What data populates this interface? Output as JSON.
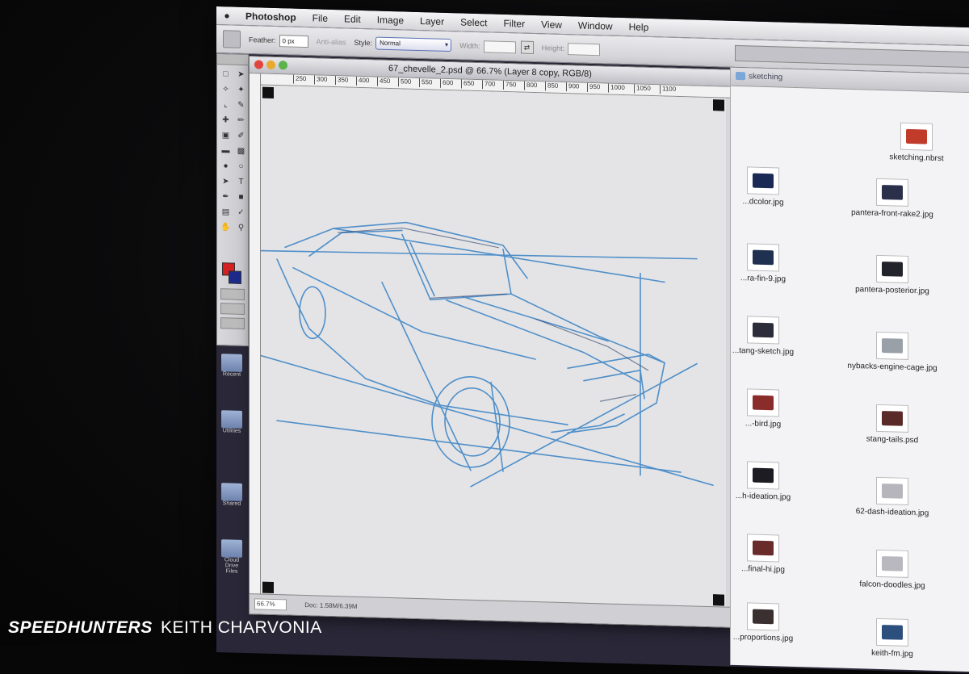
{
  "menubar": {
    "app": "Photoshop",
    "items": [
      "File",
      "Edit",
      "Image",
      "Layer",
      "Select",
      "Filter",
      "View",
      "Window",
      "Help"
    ]
  },
  "options": {
    "feather_label": "Feather:",
    "feather_value": "0 px",
    "antialias_label": "Anti-alias",
    "style_label": "Style:",
    "style_value": "Normal",
    "width_label": "Width:",
    "height_label": "Height:"
  },
  "document": {
    "title": "67_chevelle_2.psd @ 66.7% (Layer 8 copy, RGB/8)",
    "ruler_ticks": [
      "250",
      "300",
      "350",
      "400",
      "450",
      "500",
      "550",
      "600",
      "650",
      "700",
      "750",
      "800",
      "850",
      "900",
      "950",
      "1000",
      "1050",
      "1100"
    ],
    "status_doc": "Doc: 1.58M/6.39M"
  },
  "finder": {
    "folder": "sketching",
    "items": [
      {
        "name": "sketching.nbrst",
        "color": "#c13b2b"
      },
      {
        "name": "...dcolor.jpg",
        "color": "#1b2a55"
      },
      {
        "name": "pantera-front-rake2.jpg",
        "color": "#2a2f4a"
      },
      {
        "name": "...ra-fin-9.jpg",
        "color": "#203050"
      },
      {
        "name": "pantera-posterior.jpg",
        "color": "#22232b"
      },
      {
        "name": "...tang-sketch.jpg",
        "color": "#2b2d3a"
      },
      {
        "name": "nybacks-engine-cage.jpg",
        "color": "#9aa0a8"
      },
      {
        "name": "...-bird.jpg",
        "color": "#8a2c2a"
      },
      {
        "name": "stang-tails.psd",
        "color": "#5a2a28"
      },
      {
        "name": "...h-ideation.jpg",
        "color": "#1c1c22"
      },
      {
        "name": "62-dash-ideation.jpg",
        "color": "#b5b5bb"
      },
      {
        "name": "...final-hi.jpg",
        "color": "#6a2b2b"
      },
      {
        "name": "falcon-doodles.jpg",
        "color": "#b8b8be"
      },
      {
        "name": "...proportions.jpg",
        "color": "#3a3030"
      },
      {
        "name": "keith-fm.jpg",
        "color": "#2c4f7e"
      }
    ]
  },
  "desktop": [
    "Recent",
    "Utilities",
    "Shared",
    "Cloud Drive Files"
  ],
  "watermark": {
    "brand": "SPEEDHUNTERS",
    "author": "KEITH CHARVONIA"
  }
}
